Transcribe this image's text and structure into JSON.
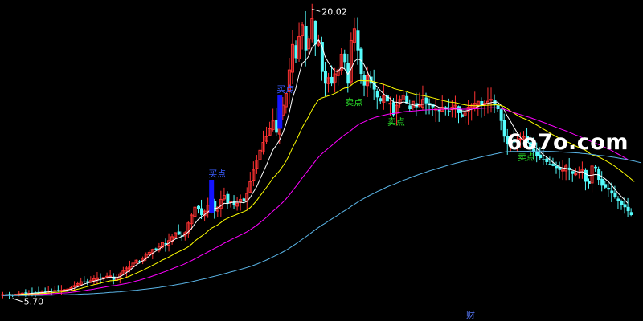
{
  "watermark": "6o7o.com",
  "colors": {
    "background": "#000000",
    "up_candle": "#ff3232",
    "down_candle": "#54fcfc",
    "ma_fast": "#ffffff",
    "ma_mid": "#ffff00",
    "ma_slow": "#ff00ff",
    "ma_long": "#5ab4e6",
    "buy_label": "#3a5cff",
    "sell_label": "#28d828",
    "marker_bar": "#1414ff",
    "marker_bar_green": "#18d818",
    "annotation_text": "#ffffff",
    "footer_text": "#5a7cff"
  },
  "chart_data": {
    "type": "candlestick",
    "title": "",
    "xlabel": "",
    "ylabel": "",
    "ylim": [
      5.3,
      20.6
    ],
    "grid": false,
    "annotations": {
      "high_label": "20.02",
      "low_label": "5.70",
      "footer_label": "财"
    },
    "signals": [
      {
        "text": "买点",
        "index": 64,
        "kind": "buy"
      },
      {
        "text": "买点",
        "index": 85,
        "kind": "buy"
      },
      {
        "text": "卖点",
        "index": 106,
        "kind": "sell"
      },
      {
        "text": "卖点",
        "index": 119,
        "kind": "sell"
      },
      {
        "text": "卖点",
        "index": 159,
        "kind": "sell"
      }
    ],
    "close": [
      5.75,
      5.73,
      5.74,
      5.72,
      5.76,
      5.79,
      5.82,
      5.8,
      5.81,
      5.83,
      5.84,
      5.86,
      5.87,
      5.9,
      5.92,
      5.94,
      5.96,
      5.93,
      5.97,
      6.0,
      6.03,
      6.1,
      6.2,
      6.3,
      6.4,
      6.38,
      6.35,
      6.45,
      6.55,
      6.6,
      6.58,
      6.62,
      6.68,
      6.7,
      6.5,
      6.6,
      6.8,
      6.95,
      7.1,
      7.2,
      7.35,
      7.5,
      7.45,
      7.6,
      7.8,
      7.9,
      8.05,
      8.0,
      8.2,
      8.4,
      8.3,
      8.5,
      8.7,
      8.9,
      8.8,
      8.7,
      8.9,
      9.4,
      9.8,
      10.2,
      10.1,
      9.8,
      10.0,
      10.3,
      10.5,
      10.0,
      10.2,
      10.6,
      10.8,
      10.4,
      10.5,
      10.3,
      10.4,
      10.6,
      10.5,
      10.9,
      11.5,
      12.1,
      12.6,
      13.1,
      13.5,
      13.8,
      14.2,
      14.6,
      14.0,
      14.8,
      15.4,
      16.0,
      17.2,
      18.5,
      17.8,
      18.9,
      19.5,
      18.2,
      18.8,
      19.8,
      18.5,
      18.7,
      17.1,
      16.5,
      16.8,
      16.5,
      17.0,
      17.2,
      18.0,
      17.6,
      16.5,
      18.7,
      19.3,
      18.2,
      17.0,
      16.4,
      16.9,
      16.5,
      16.2,
      15.8,
      15.6,
      15.9,
      15.6,
      15.5,
      14.9,
      15.4,
      15.7,
      15.9,
      15.5,
      15.2,
      15.6,
      15.3,
      15.4,
      15.7,
      15.5,
      15.4,
      15.3,
      15.2,
      15.1,
      15.3,
      15.2,
      15.1,
      15.3,
      15.4,
      15.0,
      14.8,
      15.0,
      15.3,
      15.4,
      15.5,
      15.6,
      15.4,
      15.5,
      15.6,
      15.7,
      15.4,
      15.2,
      14.6,
      13.8,
      13.4,
      13.6,
      13.5,
      13.6,
      13.7,
      13.8,
      13.5,
      13.2,
      13.0,
      12.8,
      12.7,
      12.6,
      12.5,
      12.4,
      12.3,
      12.2,
      12.1,
      12.1,
      12.3,
      12.1,
      11.9,
      11.9,
      12.0,
      12.1,
      11.5,
      11.4,
      12.3,
      12.2,
      11.6,
      11.3,
      11.2,
      11.1,
      10.9,
      10.7,
      10.5,
      10.3,
      10.2,
      10.0,
      9.8
    ],
    "series": [
      {
        "values": [
          5.7,
          5.73,
          5.74,
          5.74,
          5.74,
          5.75,
          5.77,
          5.78,
          5.79,
          5.81,
          5.82,
          5.83,
          5.85,
          5.86,
          5.88,
          5.91,
          5.93,
          5.93,
          5.94,
          5.96,
          5.98,
          6.02,
          6.07,
          6.14,
          6.21,
          6.28,
          6.33,
          6.38,
          6.43,
          6.47,
          6.51,
          6.55,
          6.61,
          6.64,
          6.62,
          6.62,
          6.66,
          6.75,
          6.87,
          6.97,
          7.13,
          7.26,
          7.37,
          7.47,
          7.58,
          7.71,
          7.86,
          7.96,
          8.06,
          8.19,
          8.26,
          8.37,
          8.48,
          8.58,
          8.64,
          8.72,
          8.82,
          8.94,
          9.12,
          9.36,
          9.58,
          9.69,
          9.82,
          9.96,
          10.1,
          10.13,
          10.16,
          10.27,
          10.4,
          10.38,
          10.43,
          10.46,
          10.46,
          10.45,
          10.43,
          10.5,
          10.7,
          10.98,
          11.25,
          11.63,
          11.99,
          12.36,
          12.74,
          13.12,
          13.35,
          13.62,
          13.98,
          14.44,
          15.02,
          15.77,
          16.26,
          16.97,
          17.54,
          17.68,
          17.91,
          18.36,
          18.52,
          18.73,
          18.43,
          17.88,
          17.58,
          17.33,
          17.14,
          17.11,
          17.34,
          17.25,
          16.97,
          17.25,
          17.63,
          17.76,
          17.69,
          17.47,
          17.11,
          16.74,
          16.48,
          16.34,
          16.14,
          15.98,
          15.83,
          15.75,
          15.57,
          15.55,
          15.52,
          15.57,
          15.54,
          15.46,
          15.42,
          15.37,
          15.45,
          15.45,
          15.47,
          15.43,
          15.4,
          15.38,
          15.29,
          15.27,
          15.24,
          15.2,
          15.2,
          15.24,
          15.2,
          15.12,
          15.1,
          15.14,
          15.19,
          15.24,
          15.34,
          15.4,
          15.46,
          15.49,
          15.53,
          15.57,
          15.56,
          15.41,
          15.17,
          14.83,
          14.57,
          14.28,
          14.0,
          13.75,
          13.61,
          13.53,
          13.42,
          13.31,
          13.21,
          13.04,
          12.88,
          12.76,
          12.63,
          12.49,
          12.37,
          12.26,
          12.2,
          12.18,
          12.14,
          12.09,
          12.04,
          11.99,
          12.01,
          11.91,
          11.82,
          11.83,
          11.87,
          11.85,
          11.77,
          11.65,
          11.52,
          11.33,
          11.13,
          10.92,
          10.75,
          10.58,
          10.4
        ]
      },
      {
        "values": [
          5.7,
          5.71,
          5.72,
          5.73,
          5.73,
          5.74,
          5.75,
          5.76,
          5.76,
          5.77,
          5.78,
          5.79,
          5.8,
          5.81,
          5.82,
          5.84,
          5.86,
          5.87,
          5.88,
          5.9,
          5.92,
          5.95,
          5.98,
          6.02,
          6.06,
          6.11,
          6.15,
          6.2,
          6.25,
          6.29,
          6.33,
          6.37,
          6.41,
          6.45,
          6.46,
          6.48,
          6.52,
          6.57,
          6.63,
          6.69,
          6.77,
          6.84,
          6.91,
          6.98,
          7.07,
          7.15,
          7.24,
          7.32,
          7.41,
          7.51,
          7.58,
          7.66,
          7.75,
          7.85,
          7.93,
          8.01,
          8.09,
          8.19,
          8.32,
          8.48,
          8.61,
          8.72,
          8.84,
          8.98,
          9.12,
          9.21,
          9.3,
          9.42,
          9.55,
          9.63,
          9.71,
          9.77,
          9.84,
          9.91,
          9.97,
          10.05,
          10.18,
          10.35,
          10.54,
          10.77,
          10.99,
          11.21,
          11.44,
          11.68,
          11.86,
          12.06,
          12.29,
          12.54,
          12.86,
          13.23,
          13.55,
          13.91,
          14.27,
          14.55,
          14.84,
          15.17,
          15.44,
          15.68,
          15.77,
          15.82,
          15.88,
          15.93,
          16.0,
          16.08,
          16.2,
          16.27,
          16.29,
          16.41,
          16.55,
          16.64,
          16.66,
          16.64,
          16.65,
          16.63,
          16.6,
          16.55,
          16.5,
          16.46,
          16.4,
          16.35,
          16.26,
          16.21,
          16.17,
          16.14,
          16.09,
          16.03,
          15.99,
          15.94,
          15.92,
          15.89,
          15.86,
          15.82,
          15.78,
          15.74,
          15.69,
          15.65,
          15.61,
          15.57,
          15.55,
          15.53,
          15.49,
          15.45,
          15.42,
          15.39,
          15.38,
          15.37,
          15.38,
          15.38,
          15.39,
          15.4,
          15.41,
          15.42,
          15.42,
          15.39,
          15.33,
          15.22,
          15.1,
          15.0,
          14.89,
          14.8,
          14.73,
          14.66,
          14.58,
          14.48,
          14.39,
          14.29,
          14.19,
          14.09,
          13.99,
          13.89,
          13.8,
          13.71,
          13.62,
          13.55,
          13.49,
          13.41,
          13.32,
          13.24,
          13.17,
          13.1,
          12.98,
          12.87,
          12.82,
          12.77,
          12.68,
          12.59,
          12.5,
          12.4,
          12.29,
          12.17,
          12.04,
          11.91,
          11.78,
          11.64,
          11.5
        ]
      },
      {
        "values": [
          5.7,
          5.7,
          5.71,
          5.71,
          5.72,
          5.72,
          5.73,
          5.73,
          5.74,
          5.74,
          5.75,
          5.75,
          5.76,
          5.77,
          5.78,
          5.79,
          5.8,
          5.81,
          5.82,
          5.83,
          5.84,
          5.86,
          5.88,
          5.9,
          5.93,
          5.95,
          5.98,
          6.0,
          6.03,
          6.06,
          6.09,
          6.12,
          6.15,
          6.18,
          6.2,
          6.22,
          6.25,
          6.28,
          6.31,
          6.35,
          6.39,
          6.44,
          6.48,
          6.53,
          6.58,
          6.63,
          6.69,
          6.75,
          6.81,
          6.87,
          6.93,
          6.99,
          7.06,
          7.13,
          7.19,
          7.25,
          7.32,
          7.4,
          7.48,
          7.57,
          7.66,
          7.75,
          7.83,
          7.92,
          8.01,
          8.1,
          8.18,
          8.27,
          8.37,
          8.45,
          8.54,
          8.62,
          8.7,
          8.78,
          8.86,
          8.95,
          9.05,
          9.16,
          9.28,
          9.41,
          9.55,
          9.69,
          9.84,
          10.0,
          10.14,
          10.29,
          10.45,
          10.62,
          10.82,
          11.04,
          11.25,
          11.47,
          11.7,
          11.91,
          12.12,
          12.34,
          12.55,
          12.75,
          12.92,
          13.06,
          13.2,
          13.34,
          13.48,
          13.62,
          13.76,
          13.89,
          13.99,
          14.12,
          14.26,
          14.38,
          14.48,
          14.55,
          14.63,
          14.7,
          14.76,
          14.81,
          14.85,
          14.89,
          14.93,
          14.96,
          14.98,
          15.0,
          15.03,
          15.06,
          15.08,
          15.09,
          15.11,
          15.12,
          15.14,
          15.15,
          15.16,
          15.17,
          15.18,
          15.19,
          15.19,
          15.2,
          15.2,
          15.2,
          15.21,
          15.21,
          15.21,
          15.2,
          15.2,
          15.2,
          15.21,
          15.22,
          15.23,
          15.24,
          15.25,
          15.26,
          15.27,
          15.27,
          15.27,
          15.25,
          15.2,
          15.14,
          15.08,
          15.02,
          14.97,
          14.92,
          14.87,
          14.82,
          14.77,
          14.71,
          14.65,
          14.59,
          14.53,
          14.47,
          14.4,
          14.34,
          14.27,
          14.21,
          14.15,
          14.09,
          14.02,
          13.95,
          13.88,
          13.82,
          13.74,
          13.66,
          13.6,
          13.54,
          13.47,
          13.4,
          13.33,
          13.25,
          13.17,
          13.09,
          13.0,
          12.91,
          12.82,
          12.73,
          12.63
        ]
      },
      {
        "values": [
          5.7,
          5.7,
          5.7,
          5.7,
          5.7,
          5.7,
          5.7,
          5.7,
          5.71,
          5.71,
          5.71,
          5.71,
          5.71,
          5.72,
          5.72,
          5.72,
          5.73,
          5.73,
          5.73,
          5.74,
          5.74,
          5.75,
          5.75,
          5.76,
          5.77,
          5.78,
          5.78,
          5.79,
          5.8,
          5.81,
          5.82,
          5.83,
          5.85,
          5.86,
          5.87,
          5.88,
          5.89,
          5.91,
          5.92,
          5.94,
          5.96,
          5.97,
          5.99,
          6.01,
          6.03,
          6.05,
          6.07,
          6.09,
          6.11,
          6.14,
          6.16,
          6.19,
          6.21,
          6.24,
          6.27,
          6.3,
          6.33,
          6.36,
          6.4,
          6.44,
          6.48,
          6.52,
          6.55,
          6.59,
          6.64,
          6.68,
          6.72,
          6.76,
          6.81,
          6.85,
          6.9,
          6.94,
          6.99,
          7.03,
          7.08,
          7.13,
          7.18,
          7.24,
          7.3,
          7.37,
          7.44,
          7.51,
          7.59,
          7.67,
          7.75,
          7.83,
          7.92,
          8.01,
          8.11,
          8.22,
          8.33,
          8.45,
          8.57,
          8.68,
          8.8,
          8.93,
          9.05,
          9.17,
          9.28,
          9.38,
          9.49,
          9.59,
          9.7,
          9.8,
          9.92,
          10.02,
          10.12,
          10.24,
          10.35,
          10.46,
          10.56,
          10.65,
          10.74,
          10.83,
          10.91,
          11.0,
          11.07,
          11.15,
          11.23,
          11.3,
          11.36,
          11.43,
          11.5,
          11.57,
          11.63,
          11.7,
          11.76,
          11.82,
          11.88,
          11.93,
          11.99,
          12.05,
          12.1,
          12.15,
          12.2,
          12.25,
          12.3,
          12.35,
          12.39,
          12.44,
          12.48,
          12.52,
          12.56,
          12.6,
          12.64,
          12.68,
          12.72,
          12.76,
          12.8,
          12.84,
          12.87,
          12.91,
          12.94,
          12.98,
          13.01,
          13.03,
          13.04,
          13.04,
          13.04,
          13.05,
          13.05,
          13.05,
          13.06,
          13.06,
          13.06,
          13.06,
          13.06,
          13.05,
          13.05,
          13.04,
          13.03,
          13.02,
          13.01,
          13.0,
          12.99,
          12.98,
          12.97,
          12.96,
          12.94,
          12.93,
          12.91,
          12.89,
          12.87,
          12.84,
          12.83,
          12.81,
          12.79,
          12.76,
          12.74,
          12.71,
          12.68,
          12.65,
          12.62,
          12.58,
          12.55,
          12.51,
          12.47
        ]
      }
    ]
  }
}
